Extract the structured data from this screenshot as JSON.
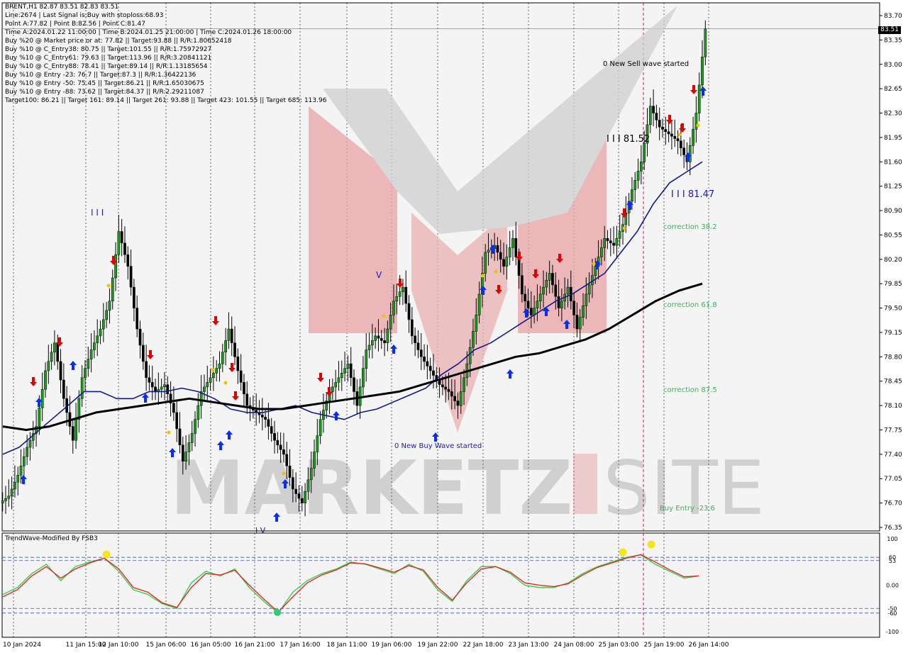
{
  "header": {
    "symbol_line": "BRENT,H1  82.87 83.51 82.83 83.51",
    "info_lines": [
      "Line:2674 | Last Signal is:Buy with stoploss:68.93",
      "Point A:77.82 | Point B:82.56 | Point C:81.47",
      "Time A:2024.01.22 11:00:00 | Time B:2024.01.25 21:00:00 | Time C:2024.01.26 18:00:00",
      "Buy %20 @ Market price or at: 77.82 || Target:93.88 || R/R:1.80652418",
      "Buy %10 @ C_Entry38: 80.75 || Target:101.55 || R/R:1.75972927",
      "Buy %10 @ C_Entry61: 79.63 || Target:113.96 || R/R:3.20841121",
      "Buy %10 @ C_Entry88: 78.41 || Target:89.14 || R/R:1.13185654",
      "Buy %10 @ Entry -23: 76.7 || Target:87.3 || R/R:1.36422136",
      "Buy %10 @ Entry -50: 75.45 || Target:86.21 || R/R:1.65030675",
      "Buy %10 @ Entry -88: 73.62 || Target:84.37 || R/R:2.29211087",
      "Target100: 86.21 || Target 161: 89.14 || Target 261: 93.88 || Target 423: 101.55 || Target 685: 113.96"
    ]
  },
  "price_tag": "83.51",
  "annotations": {
    "sell_wave": "0 New Sell wave started",
    "buy_wave": "0 New Buy Wave started",
    "wave_b": "I I I 81.52",
    "wave_c": "I I I 81.47",
    "wave_iii_left": "I I I",
    "wave_v": "V",
    "wave_iv": "I V",
    "correction_382": "correction 38.2",
    "correction_618": "correction 61.8",
    "correction_875": "correction 87.5",
    "buy_entry": "Buy Entry -23.6"
  },
  "oscillator": {
    "title": "TrendWave-Modified By FSB3",
    "levels": [
      "100",
      "60",
      "53",
      "0.00",
      "-50",
      "-60",
      "-100"
    ]
  },
  "watermark": {
    "text_left": "MARKETZ",
    "text_right": "SITE"
  },
  "colors": {
    "bull_candle": "#1a9c1a",
    "bear_candle": "#000000",
    "ma_fast": "#101a8c",
    "ma_slow": "#000000",
    "buy_arrow": "#0a2ef0",
    "sell_arrow": "#e00000",
    "correction_text": "#3cae5a",
    "osc_green": "#2ecc40",
    "osc_red": "#e02020"
  },
  "chart_data": {
    "type": "candlestick",
    "symbol": "BRENT",
    "timeframe": "H1",
    "last": {
      "open": 82.87,
      "high": 83.51,
      "low": 82.83,
      "close": 83.51
    },
    "y_ticks": [
      83.7,
      83.35,
      83.0,
      82.65,
      82.3,
      81.95,
      81.6,
      81.25,
      80.9,
      80.55,
      80.2,
      79.85,
      79.5,
      79.15,
      78.8,
      78.45,
      78.1,
      77.75,
      77.4,
      77.05,
      76.7,
      76.35
    ],
    "ylim": [
      76.35,
      83.7
    ],
    "x_ticks": [
      "10 Jan 2024",
      "11 Jan 15:00",
      "12 Jan 10:00",
      "15 Jan 06:00",
      "16 Jan 05:00",
      "16 Jan 21:00",
      "17 Jan 16:00",
      "18 Jan 11:00",
      "19 Jan 06:00",
      "19 Jan 22:00",
      "22 Jan 18:00",
      "23 Jan 13:00",
      "24 Jan 08:00",
      "25 Jan 03:00",
      "25 Jan 19:00",
      "26 Jan 14:00"
    ],
    "close_path": [
      76.8,
      77.1,
      77.5,
      77.8,
      78.6,
      79.0,
      78.2,
      77.6,
      78.5,
      78.9,
      79.2,
      79.6,
      80.6,
      80.1,
      79.2,
      78.5,
      78.3,
      78.4,
      78.0,
      77.3,
      77.7,
      78.3,
      78.5,
      78.7,
      79.2,
      78.6,
      78.1,
      78.0,
      77.9,
      77.6,
      77.4,
      76.9,
      76.7,
      77.2,
      77.9,
      78.3,
      78.5,
      78.7,
      78.1,
      78.9,
      79.1,
      79.0,
      79.6,
      79.8,
      79.1,
      78.8,
      78.6,
      78.4,
      78.3,
      78.1,
      78.7,
      79.4,
      80.3,
      80.4,
      80.1,
      80.5,
      79.7,
      79.4,
      79.7,
      80.0,
      79.5,
      79.8,
      79.2,
      79.7,
      80.1,
      80.5,
      80.4,
      80.7,
      81.2,
      81.6,
      82.4,
      82.1,
      82.0,
      81.9,
      81.6,
      82.3,
      83.51
    ],
    "ma_fast": [
      77.4,
      77.5,
      77.7,
      77.9,
      78.1,
      78.3,
      78.3,
      78.2,
      78.2,
      78.3,
      78.3,
      78.35,
      78.3,
      78.2,
      78.05,
      78.0,
      78.0,
      78.05,
      78.1,
      78.0,
      77.95,
      77.9,
      78.0,
      78.05,
      78.15,
      78.25,
      78.35,
      78.55,
      78.7,
      78.9,
      79.0,
      79.15,
      79.3,
      79.45,
      79.6,
      79.7,
      79.85,
      80.0,
      80.3,
      80.6,
      81.0,
      81.3,
      81.45,
      81.6
    ],
    "ma_slow": [
      77.8,
      77.75,
      77.8,
      77.9,
      78.0,
      78.05,
      78.1,
      78.15,
      78.2,
      78.15,
      78.1,
      78.05,
      78.05,
      78.1,
      78.15,
      78.2,
      78.25,
      78.3,
      78.4,
      78.5,
      78.6,
      78.7,
      78.8,
      78.85,
      78.95,
      79.05,
      79.2,
      79.4,
      79.6,
      79.75,
      79.85
    ],
    "osc_ylim": [
      -100,
      100
    ],
    "osc_green": [
      -20,
      -5,
      25,
      45,
      10,
      40,
      50,
      58,
      30,
      -10,
      -20,
      -40,
      -50,
      5,
      30,
      20,
      35,
      -5,
      -35,
      -60,
      -15,
      10,
      25,
      35,
      50,
      45,
      35,
      25,
      45,
      30,
      -10,
      -35,
      10,
      40,
      40,
      25,
      0,
      -5,
      -5,
      5,
      25,
      40,
      50,
      60,
      65,
      45,
      30,
      15,
      20
    ],
    "osc_red": [
      -25,
      -10,
      20,
      40,
      15,
      35,
      48,
      58,
      35,
      -5,
      -15,
      -38,
      -48,
      -5,
      25,
      22,
      32,
      0,
      -30,
      -58,
      -25,
      5,
      22,
      33,
      48,
      46,
      37,
      28,
      42,
      33,
      -5,
      -32,
      5,
      35,
      40,
      28,
      5,
      0,
      -3,
      3,
      22,
      38,
      48,
      58,
      66,
      50,
      33,
      18,
      20
    ]
  }
}
